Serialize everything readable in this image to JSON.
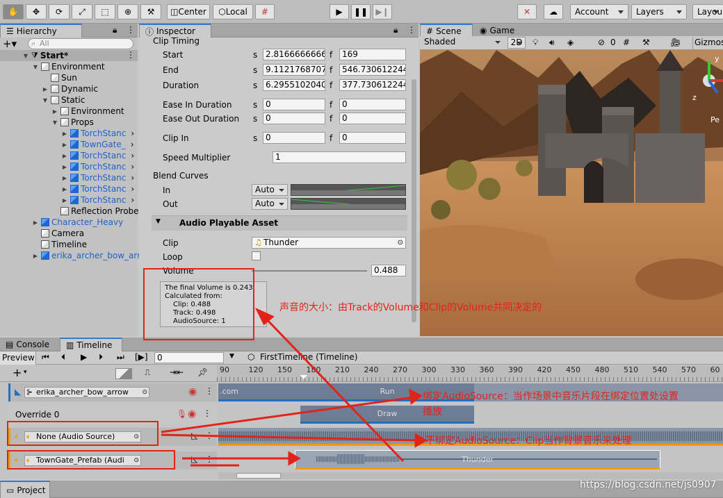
{
  "toolbar": {
    "pivot_label": "Center",
    "space_label": "Local",
    "account_label": "Account",
    "layers_label": "Layers",
    "layout_label": "Layou"
  },
  "hierarchy": {
    "tab_label": "Hierarchy",
    "search_placeholder": "All",
    "rows": [
      {
        "label": "Start*",
        "indent": 0,
        "arrow": "open",
        "icon": "unity",
        "bold": true
      },
      {
        "label": "Environment",
        "indent": 1,
        "arrow": "open",
        "icon": "cube"
      },
      {
        "label": "Sun",
        "indent": 2,
        "arrow": "none",
        "icon": "cube"
      },
      {
        "label": "Dynamic",
        "indent": 2,
        "arrow": "closed",
        "icon": "cube"
      },
      {
        "label": "Static",
        "indent": 2,
        "arrow": "open",
        "icon": "cube"
      },
      {
        "label": "Environment",
        "indent": 3,
        "arrow": "closed",
        "icon": "cube"
      },
      {
        "label": "Props",
        "indent": 3,
        "arrow": "open",
        "icon": "cube"
      },
      {
        "label": "TorchStanc",
        "indent": 4,
        "arrow": "closed",
        "icon": "blue",
        "blue": true
      },
      {
        "label": "TownGate_",
        "indent": 4,
        "arrow": "closed",
        "icon": "blue",
        "blue": true
      },
      {
        "label": "TorchStanc",
        "indent": 4,
        "arrow": "closed",
        "icon": "blue",
        "blue": true
      },
      {
        "label": "TorchStanc",
        "indent": 4,
        "arrow": "closed",
        "icon": "blue",
        "blue": true
      },
      {
        "label": "TorchStanc",
        "indent": 4,
        "arrow": "closed",
        "icon": "blue",
        "blue": true
      },
      {
        "label": "TorchStanc",
        "indent": 4,
        "arrow": "closed",
        "icon": "blue",
        "blue": true
      },
      {
        "label": "TorchStanc",
        "indent": 4,
        "arrow": "closed",
        "icon": "blue",
        "blue": true
      },
      {
        "label": "Reflection Probe",
        "indent": 3,
        "arrow": "none",
        "icon": "cube"
      },
      {
        "label": "Character_Heavy",
        "indent": 1,
        "arrow": "closed",
        "icon": "blue",
        "blue": true
      },
      {
        "label": "Camera",
        "indent": 1,
        "arrow": "none",
        "icon": "cube"
      },
      {
        "label": "Timeline",
        "indent": 1,
        "arrow": "none",
        "icon": "cube"
      },
      {
        "label": "erika_archer_bow_arro",
        "indent": 1,
        "arrow": "closed",
        "icon": "blue",
        "blue": true
      }
    ]
  },
  "inspector": {
    "tab_label": "Inspector",
    "clip_timing": "Clip Timing",
    "start_label": "Start",
    "start_s": "2.81666666666",
    "start_f": "169",
    "end_label": "End",
    "end_s": "9.11217687074",
    "end_f": "546.730612244",
    "duration_label": "Duration",
    "duration_s": "6.29551020408",
    "duration_f": "377.730612244",
    "ease_in_label": "Ease In Duration",
    "ease_in_s": "0",
    "ease_in_f": "0",
    "ease_out_label": "Ease Out Duration",
    "ease_out_s": "0",
    "ease_out_f": "0",
    "clip_in_label": "Clip In",
    "clip_in_s": "0",
    "clip_in_f": "0",
    "speed_label": "Speed Multiplier",
    "speed_value": "1",
    "s": "s",
    "f": "f",
    "blend_curves": "Blend Curves",
    "in_label": "In",
    "out_label": "Out",
    "auto": "Auto",
    "section_title": "Audio Playable Asset",
    "clip_label": "Clip",
    "clip_value": "Thunder",
    "loop_label": "Loop",
    "volume_label": "Volume",
    "volume_value": "0.488",
    "volume_fraction": 0.488,
    "info_l1": "The final Volume is 0.243",
    "info_l2": "Calculated from:",
    "info_l3": "Clip: 0.488",
    "info_l4": "Track: 0.498",
    "info_l5": "AudioSource: 1"
  },
  "scene": {
    "tab_scene": "Scene",
    "tab_game": "Game",
    "shaded": "Shaded",
    "mode_2d": "2D",
    "hidden_count": "0",
    "gizmos": "Gizmos",
    "axis_y": "y",
    "axis_z": "z",
    "persp": "Pe"
  },
  "timeline": {
    "tab_console": "Console",
    "tab_timeline": "Timeline",
    "preview": "Preview",
    "frame": "0",
    "asset": "FirstTimeline (Timeline)",
    "ticks": [
      "90",
      "120",
      "150",
      "180",
      "210",
      "240",
      "270",
      "300",
      "330",
      "360",
      "390",
      "420",
      "450",
      "480",
      "510",
      "540",
      "570",
      "60"
    ],
    "track1": "erika_archer_bow_arrow",
    "override": "Override 0",
    "track2": "None (Audio Source)",
    "track3": "TownGate_Prefab (Audi",
    "clip_com": ".com",
    "clip_run": "Run",
    "clip_draw": "Draw",
    "clip_thunder": "Thunder"
  },
  "bottom": {
    "project_tab": "Project",
    "watermark": "https://blog.csdn.net/js0907"
  },
  "annotations": {
    "a1": "声音的大小：由Track的Volume和Clip的Volume共同决定的",
    "a2_l1": "绑定AudioSource：当作场景中音乐片段在绑定位置处设置",
    "a2_l2": "播放",
    "a3": "不绑定AudioSource：Clip当作背景音乐来处理"
  },
  "colors": {
    "accent": "#3a78c8",
    "annotation": "#e2231a",
    "audio_track": "#e6a10a",
    "anim_track": "#1f6fc4"
  }
}
